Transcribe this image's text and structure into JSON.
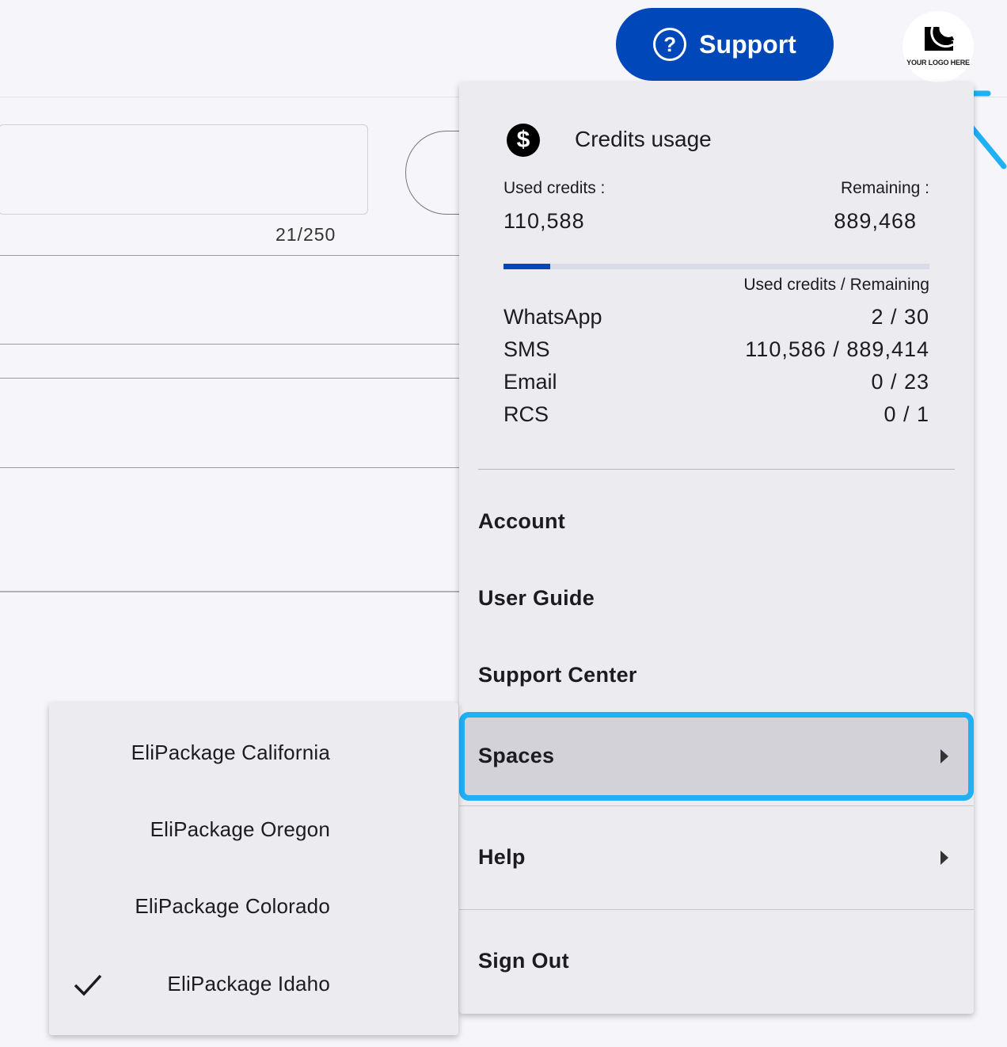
{
  "header": {
    "support_label": "Support",
    "support_icon": "question-circle-icon",
    "logo_text": "YOUR LOGO HERE"
  },
  "background": {
    "char_count": "21/250"
  },
  "credits": {
    "title": "Credits usage",
    "icon": "dollar-circle-icon",
    "used_label": "Used credits :",
    "remaining_label": "Remaining :",
    "used_value": "110,588",
    "remaining_value": "889,468",
    "used_fraction": 0.11,
    "legend": "Used credits / Remaining",
    "accent_color": "#0047b9",
    "channels": [
      {
        "name": "WhatsApp",
        "value": "2 / 30"
      },
      {
        "name": "SMS",
        "value": "110,586 / 889,414"
      },
      {
        "name": "Email",
        "value": "0 / 23"
      },
      {
        "name": "RCS",
        "value": "0 / 1"
      }
    ]
  },
  "menu": {
    "account": "Account",
    "user_guide": "User Guide",
    "support_center": "Support Center",
    "spaces": "Spaces",
    "help": "Help",
    "sign_out": "Sign Out",
    "highlight_color": "#1fb0f5"
  },
  "spaces_submenu": {
    "items": [
      {
        "label": "EliPackage California",
        "selected": false
      },
      {
        "label": "EliPackage Oregon",
        "selected": false
      },
      {
        "label": "EliPackage Colorado",
        "selected": false
      },
      {
        "label": "EliPackage Idaho",
        "selected": true
      }
    ]
  }
}
